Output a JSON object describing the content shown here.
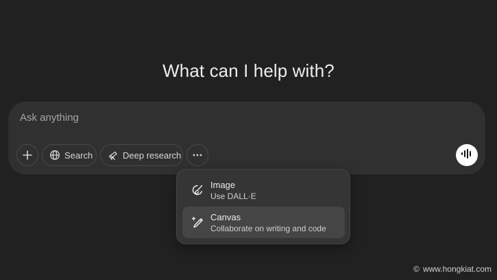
{
  "heading": "What can I help with?",
  "composer": {
    "placeholder": "Ask anything",
    "value": ""
  },
  "toolbar": {
    "add_icon": "plus-icon",
    "search_label": "Search",
    "search_icon": "globe-icon",
    "deep_research_label": "Deep research",
    "deep_research_icon": "telescope-icon",
    "more_icon": "more-dots-icon",
    "voice_icon": "voice-wave-icon"
  },
  "menu": {
    "items": [
      {
        "title": "Image",
        "subtitle": "Use DALL·E",
        "icon": "paint-brush-icon"
      },
      {
        "title": "Canvas",
        "subtitle": "Collaborate on writing and code",
        "icon": "sparkle-pen-icon"
      }
    ]
  },
  "colors": {
    "background": "#212121",
    "composer": "#303030",
    "menu": "#353535",
    "menu_highlight": "#454545",
    "text": "#ececec"
  },
  "watermark": {
    "symbol": "©",
    "text": "www.hongkiat.com"
  }
}
